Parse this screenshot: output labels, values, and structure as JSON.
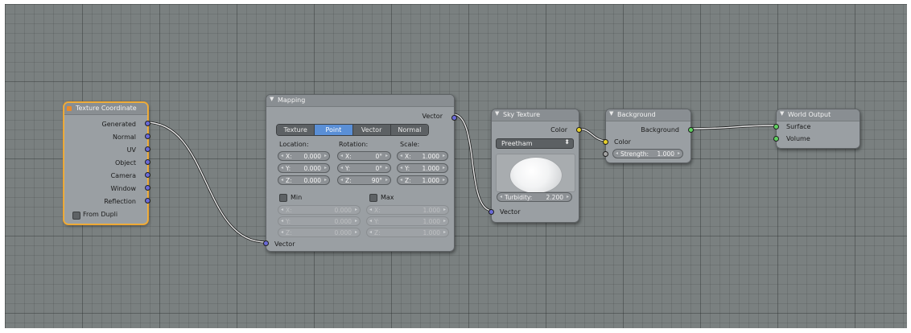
{
  "nodes": {
    "texture_coordinate": {
      "title": "Texture Coordinate",
      "outputs": [
        "Generated",
        "Normal",
        "UV",
        "Object",
        "Camera",
        "Window",
        "Reflection"
      ],
      "from_dupli": "From Dupli"
    },
    "mapping": {
      "title": "Mapping",
      "output_vector": "Vector",
      "tabs": [
        "Texture",
        "Point",
        "Vector",
        "Normal"
      ],
      "active_tab": "Point",
      "location_label": "Location:",
      "rotation_label": "Rotation:",
      "scale_label": "Scale:",
      "location": [
        {
          "k": "X:",
          "v": "0.000"
        },
        {
          "k": "Y:",
          "v": "0.000"
        },
        {
          "k": "Z:",
          "v": "0.000"
        }
      ],
      "rotation": [
        {
          "k": "X:",
          "v": "0°"
        },
        {
          "k": "Y:",
          "v": "0°"
        },
        {
          "k": "Z:",
          "v": "90°"
        }
      ],
      "scale": [
        {
          "k": "X:",
          "v": "1.000"
        },
        {
          "k": "Y:",
          "v": "1.000"
        },
        {
          "k": "Z:",
          "v": "1.000"
        }
      ],
      "min_label": "Min",
      "max_label": "Max",
      "min": [
        {
          "k": "X:",
          "v": "0.000"
        },
        {
          "k": "Y:",
          "v": "0.000"
        },
        {
          "k": "Z:",
          "v": "0.000"
        }
      ],
      "max": [
        {
          "k": "X:",
          "v": "1.000"
        },
        {
          "k": "Y:",
          "v": "1.000"
        },
        {
          "k": "Z:",
          "v": "1.000"
        }
      ],
      "input_vector": "Vector"
    },
    "sky_texture": {
      "title": "Sky Texture",
      "output_color": "Color",
      "sky_type": "Preetham",
      "turbidity_label": "Turbidity:",
      "turbidity_value": "2.200",
      "input_vector": "Vector"
    },
    "background": {
      "title": "Background",
      "output_background": "Background",
      "input_color": "Color",
      "strength_label": "Strength:",
      "strength_value": "1.000"
    },
    "world_output": {
      "title": "World Output",
      "inputs": [
        "Surface",
        "Volume"
      ]
    }
  },
  "colors": {
    "canvas": "#7a8080",
    "node_body": "#9a9fa3",
    "selected_outline": "#f2b23c",
    "active_tab": "#5a8fd6",
    "vector_socket": "#6a6ad8",
    "color_socket": "#e6d02a",
    "shader_socket": "#5fd15f",
    "float_socket": "#a4a4a4"
  }
}
